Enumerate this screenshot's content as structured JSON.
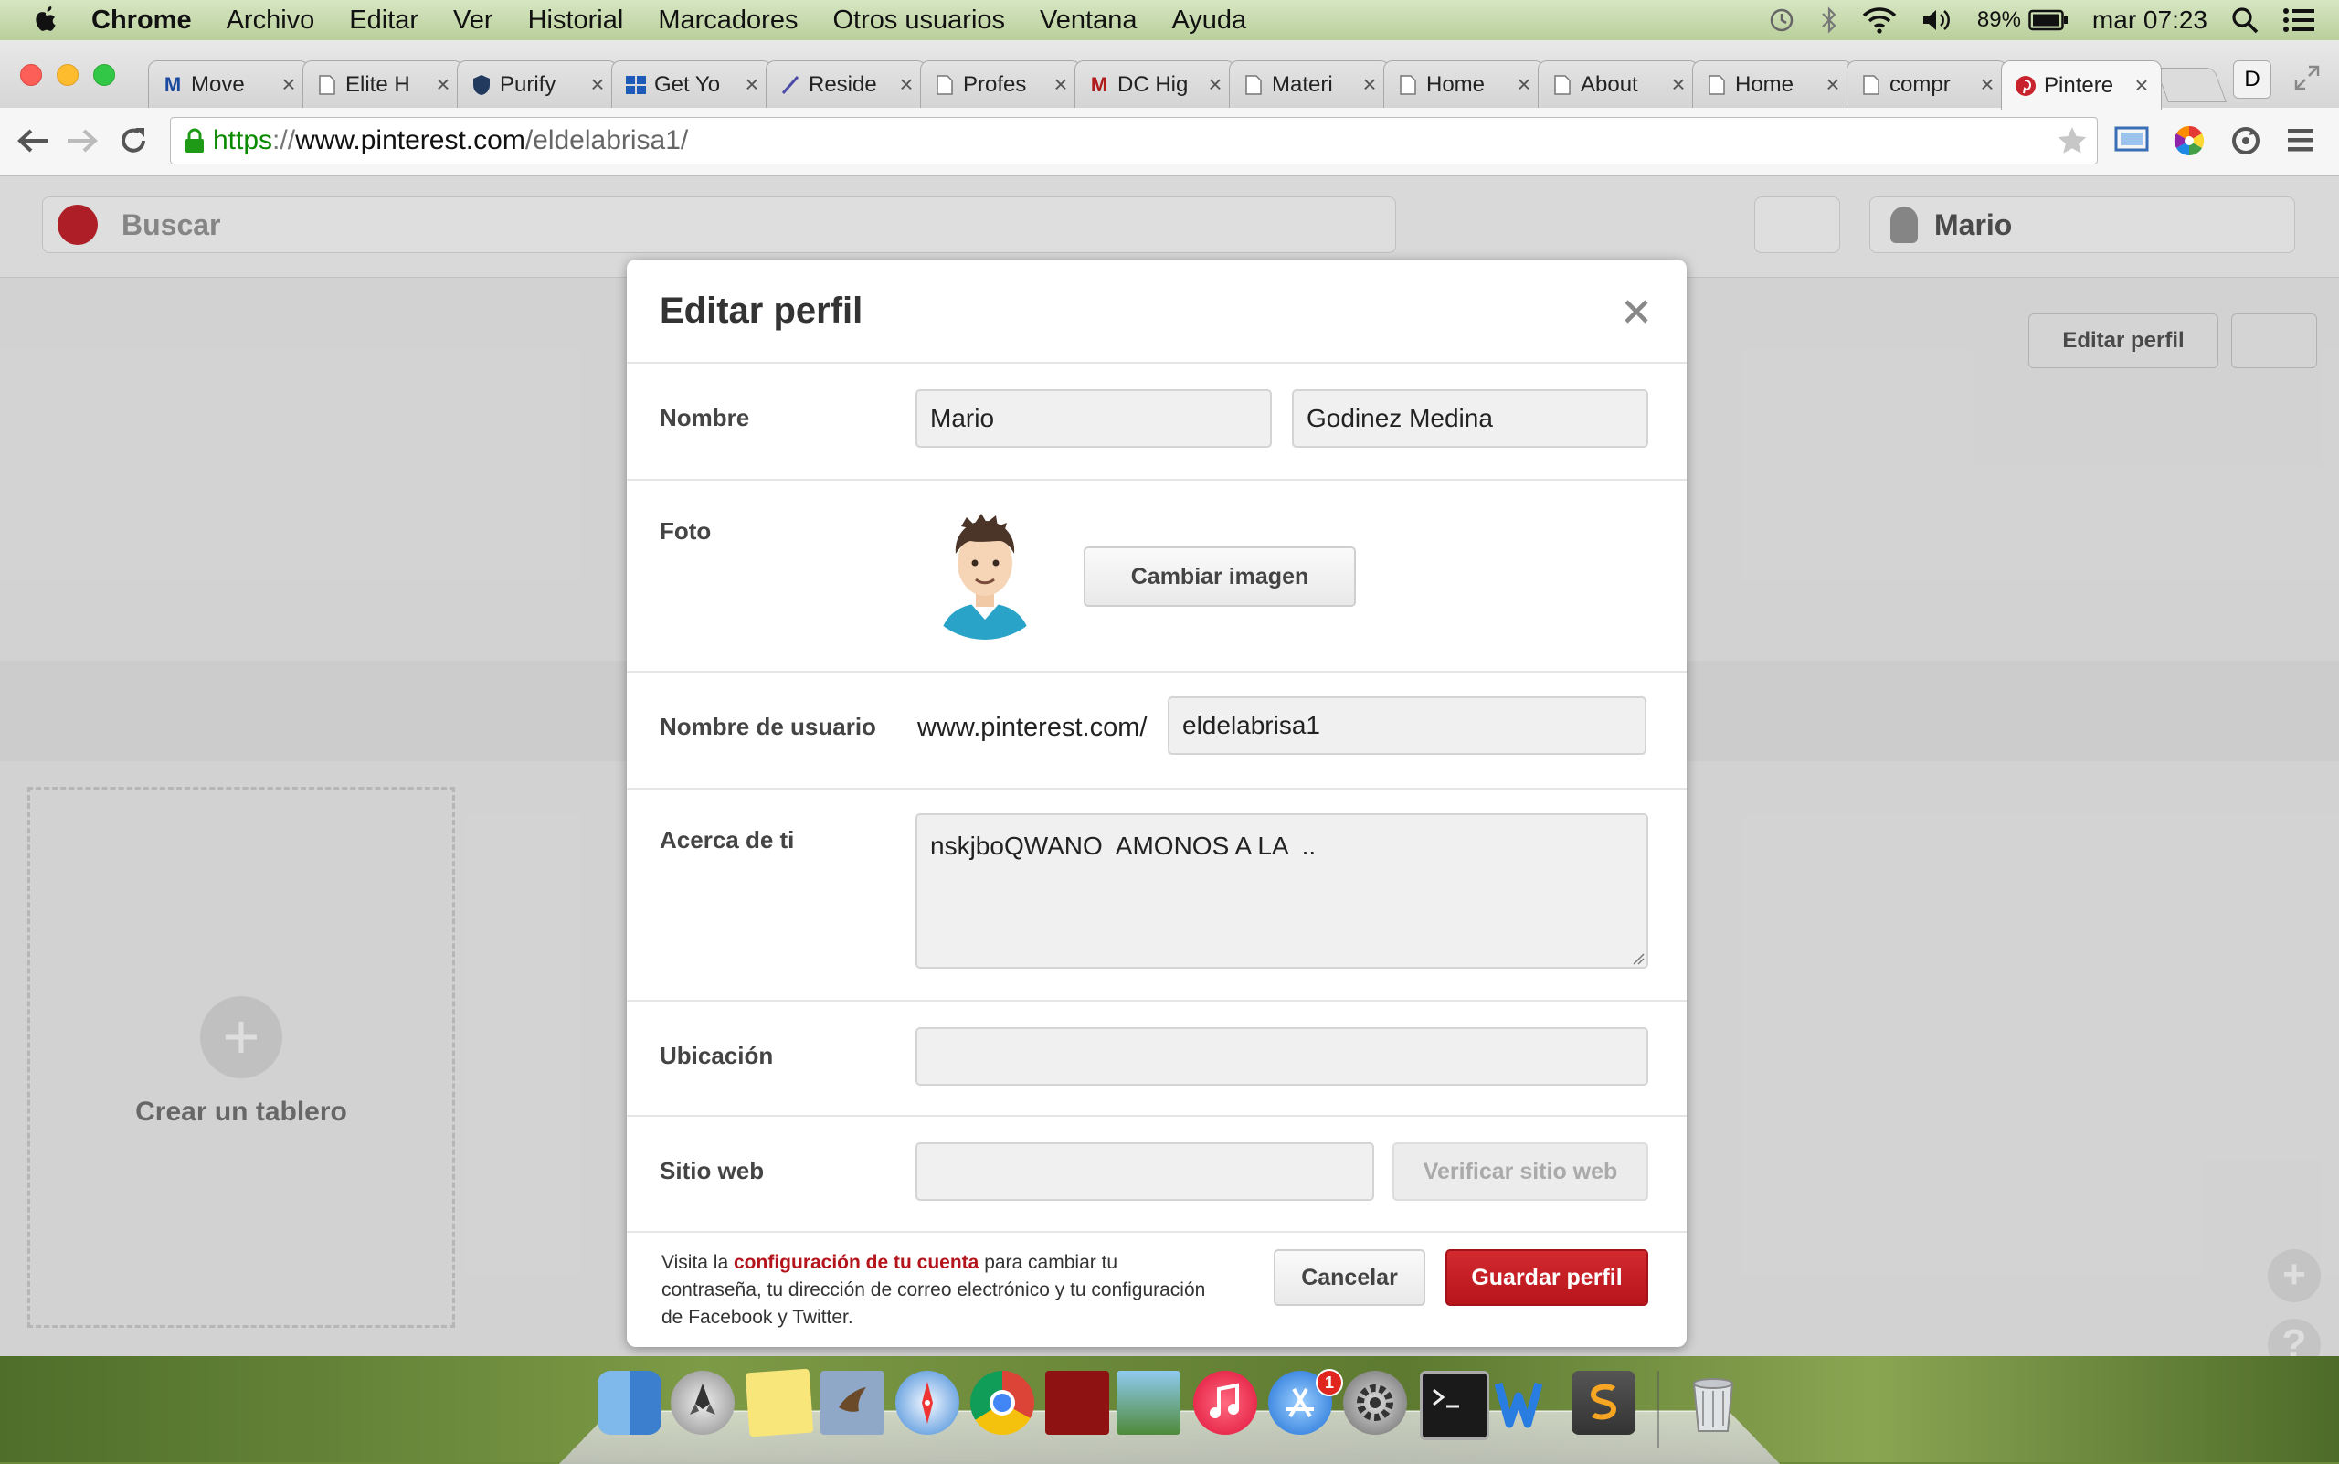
{
  "menubar": {
    "app_name": "Chrome",
    "items": [
      "Archivo",
      "Editar",
      "Ver",
      "Historial",
      "Marcadores",
      "Otros usuarios",
      "Ventana",
      "Ayuda"
    ],
    "battery": "89%",
    "clock": "mar 07:23"
  },
  "browser": {
    "tabs": [
      {
        "title": "Move",
        "icon": "M"
      },
      {
        "title": "Elite H",
        "icon": "page"
      },
      {
        "title": "Purify",
        "icon": "shield"
      },
      {
        "title": "Get Yo",
        "icon": "grid"
      },
      {
        "title": "Reside",
        "icon": "pen"
      },
      {
        "title": "Profes",
        "icon": "page"
      },
      {
        "title": "DC Hig",
        "icon": "M"
      },
      {
        "title": "Materi",
        "icon": "page"
      },
      {
        "title": "Home",
        "icon": "page"
      },
      {
        "title": "About",
        "icon": "page"
      },
      {
        "title": "Home",
        "icon": "page"
      },
      {
        "title": "compr",
        "icon": "page"
      },
      {
        "title": "Pintere",
        "icon": "pinterest",
        "active": true
      }
    ],
    "profile_initial": "D",
    "url": {
      "scheme": "https",
      "separator": "://",
      "host": "www.pinterest.com",
      "path": "/eldelabrisa1/"
    }
  },
  "pinterest": {
    "search_placeholder": "Buscar",
    "user_name": "Mario",
    "edit_profile_button": "Editar perfil",
    "create_board": "Crear un tablero"
  },
  "modal": {
    "title": "Editar perfil",
    "name_label": "Nombre",
    "first_name": "Mario",
    "last_name": "Godinez Medina",
    "photo_label": "Foto",
    "change_image_button": "Cambiar imagen",
    "username_label": "Nombre de usuario",
    "username_prefix": "www.pinterest.com/",
    "username": "eldelabrisa1",
    "about_label": "Acerca de ti",
    "about": "nskjboQWANO  AMONOS A LA  ..",
    "location_label": "Ubicación",
    "location": "",
    "website_label": "Sitio web",
    "website": "",
    "verify_button": "Verificar sitio web",
    "footer_pre": "Visita la ",
    "footer_link": "configuración de tu cuenta",
    "footer_post": " para cambiar tu contraseña, tu dirección de correo electrónico y tu configuración de Facebook y Twitter.",
    "cancel_button": "Cancelar",
    "save_button": "Guardar perfil"
  },
  "dock": {
    "apps": [
      "finder-icon",
      "launchpad-icon",
      "notes-icon",
      "mail-icon",
      "safari-icon",
      "chrome-icon",
      "photo-booth-icon",
      "iphoto-icon",
      "itunes-icon",
      "app-store-icon",
      "system-preferences-icon",
      "terminal-icon",
      "word-icon",
      "sublime-text-icon",
      "trash-icon"
    ],
    "app_store_badge": "1"
  },
  "colors": {
    "pinterest_red": "#c8232c",
    "link_red": "#b4151c",
    "url_green": "#0a8a00"
  }
}
